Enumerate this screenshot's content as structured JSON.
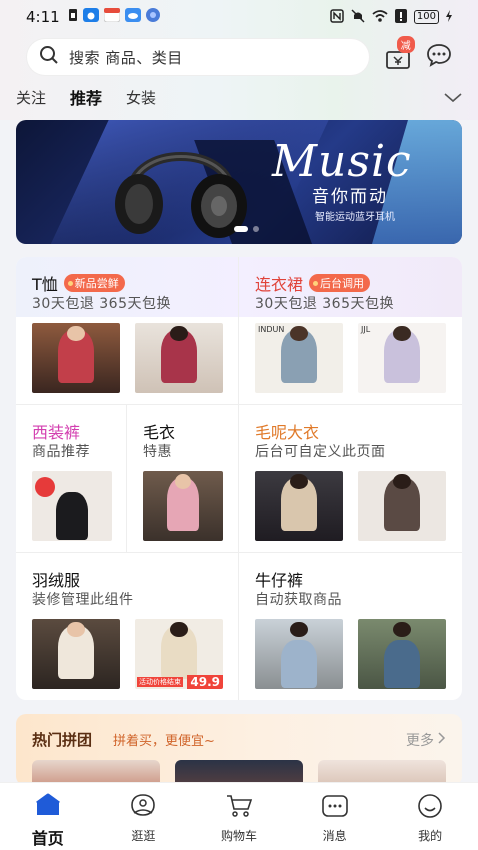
{
  "status_bar": {
    "time": "4:11",
    "battery": "100"
  },
  "search": {
    "placeholder": "搜索 商品、类目",
    "coupon_badge": "减"
  },
  "category_tabs": [
    "关注",
    "推荐",
    "女装"
  ],
  "banner": {
    "title": "Music",
    "subtitle": "音你而动",
    "caption": "智能运动蓝牙耳机"
  },
  "grid": {
    "cells": [
      {
        "title": "T恤",
        "tag": "新品尝鲜",
        "subtitle": "30天包退 365天包换",
        "title_color": "#111111"
      },
      {
        "title": "连衣裙",
        "tag": "后台调用",
        "subtitle": "30天包退 365天包换",
        "title_color": "#e0433a"
      },
      {
        "title": "西装裤",
        "subtitle": "商品推荐",
        "title_color": "#d33fb0"
      },
      {
        "title": "毛衣",
        "subtitle": "特惠",
        "title_color": "#111111"
      },
      {
        "title": "毛呢大衣",
        "subtitle": "后台可自定义此页面",
        "title_color": "#e07a2a"
      },
      {
        "title": "羽绒服",
        "subtitle": "装修管理此组件",
        "title_color": "#111111"
      },
      {
        "title": "牛仔裤",
        "subtitle": "自动获取商品",
        "title_color": "#111111"
      }
    ],
    "price_tag": "49.9",
    "thumb_label_1": "INDUN",
    "thumb_label_2": "JJL",
    "promo_text": "活动价格结束"
  },
  "group_buy": {
    "title": "热门拼团",
    "subtitle": "拼着买，更便宜~",
    "more": "更多"
  },
  "bottom_nav": [
    {
      "label": "首页",
      "icon": "home-icon",
      "active": true
    },
    {
      "label": "逛逛",
      "icon": "browse-icon",
      "active": false
    },
    {
      "label": "购物车",
      "icon": "cart-icon",
      "active": false
    },
    {
      "label": "消息",
      "icon": "message-icon",
      "active": false
    },
    {
      "label": "我的",
      "icon": "profile-icon",
      "active": false
    }
  ],
  "colors": {
    "accent": "#1f5bd8",
    "tag": "#f3694b",
    "price": "#f0443a"
  }
}
